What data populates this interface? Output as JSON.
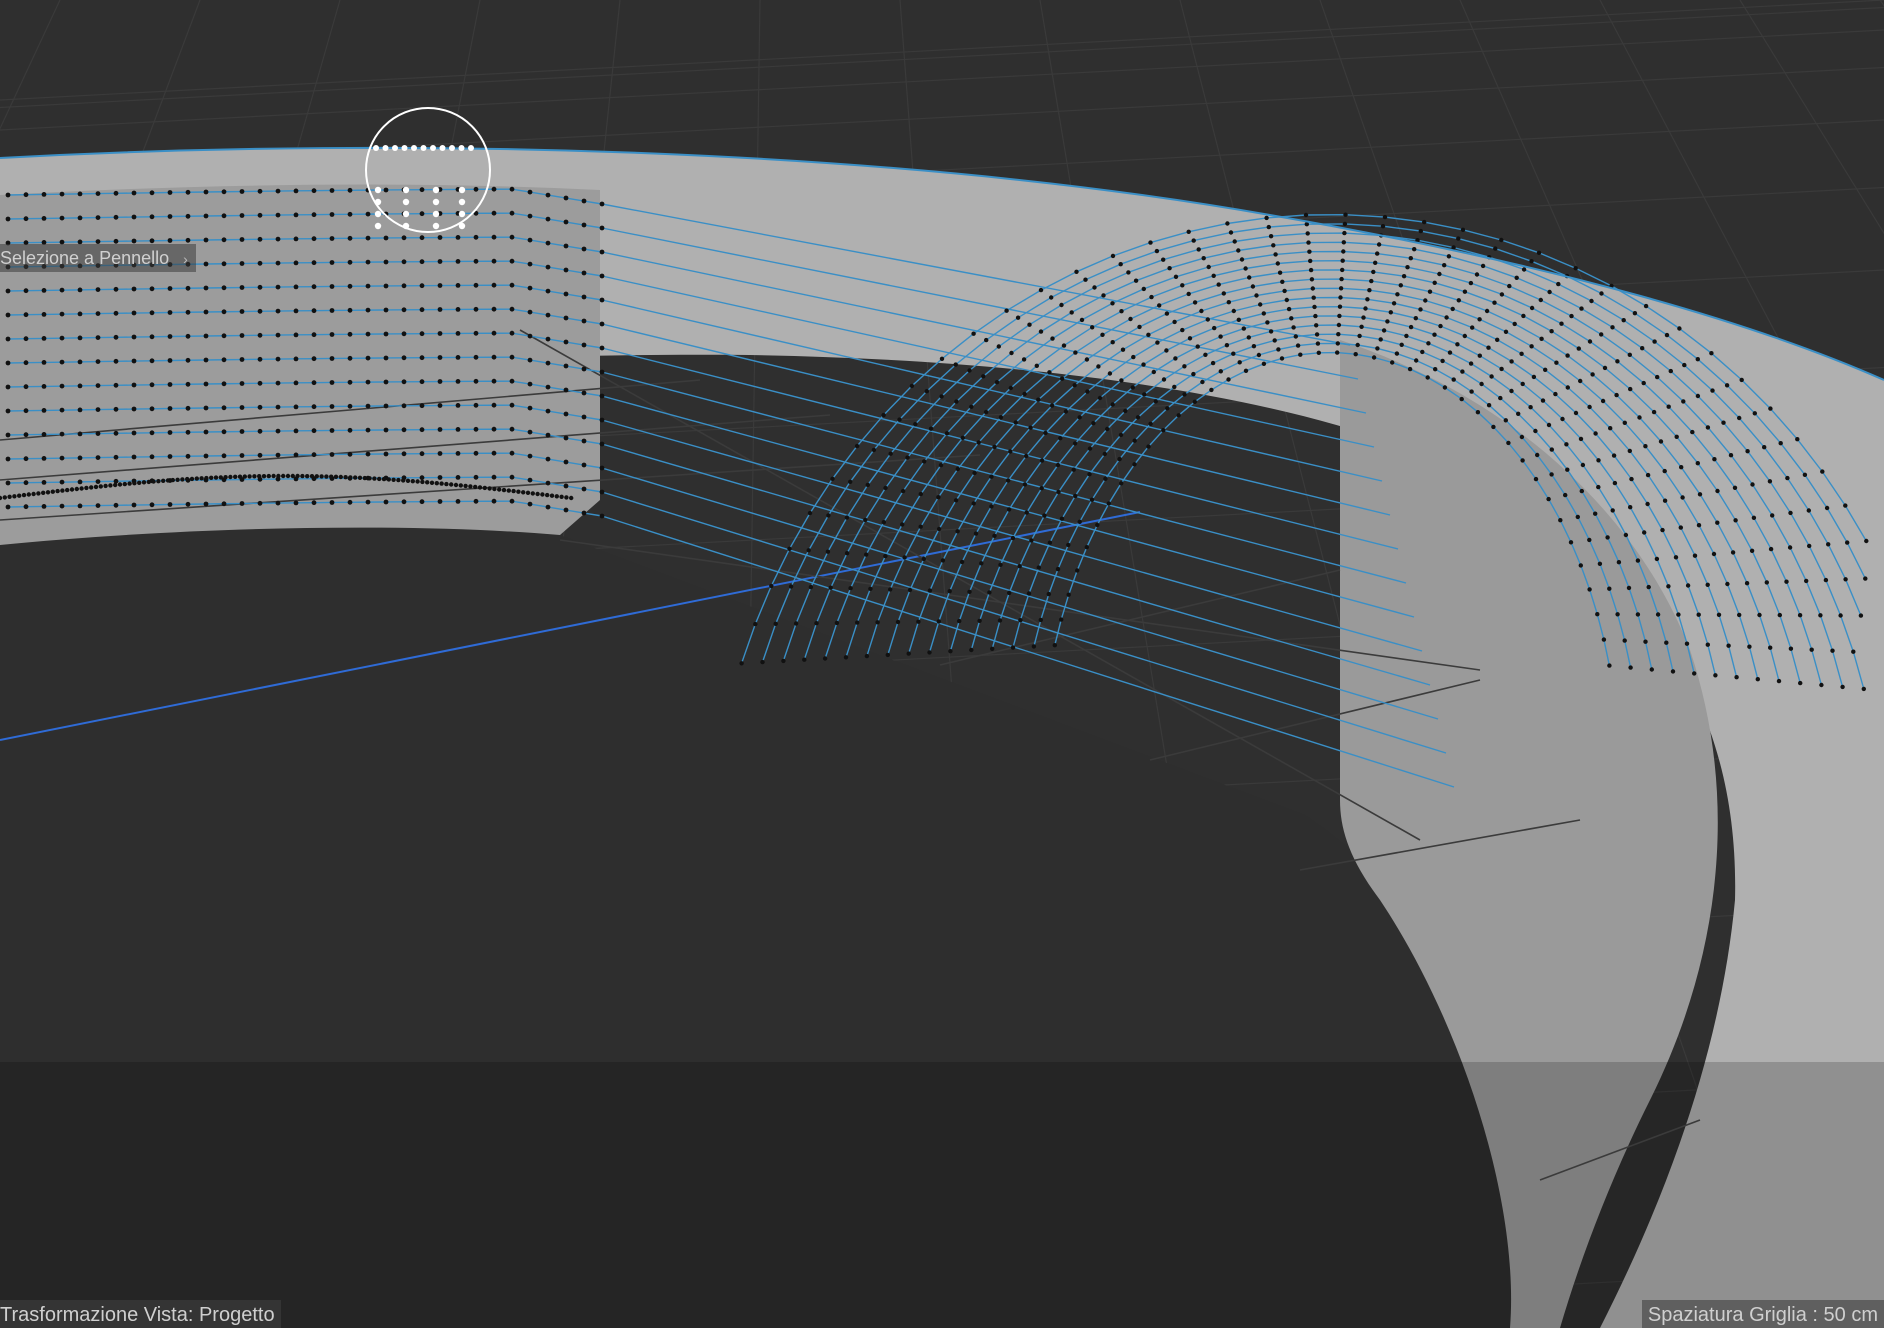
{
  "viewport": {
    "background_color": "#2f2f2f",
    "surface_color": "#aeaeae",
    "edge_color": "#3a8fc6",
    "axis_color": "#2f6bd6",
    "point_color": "#111111"
  },
  "brush_tool": {
    "label": "Selezione a Pennello",
    "chevron_icon": "chevron-right-icon"
  },
  "status": {
    "view_transform": "Trasformazione Vista: Progetto",
    "grid_spacing": "Spaziatura Griglia : 50 cm"
  }
}
